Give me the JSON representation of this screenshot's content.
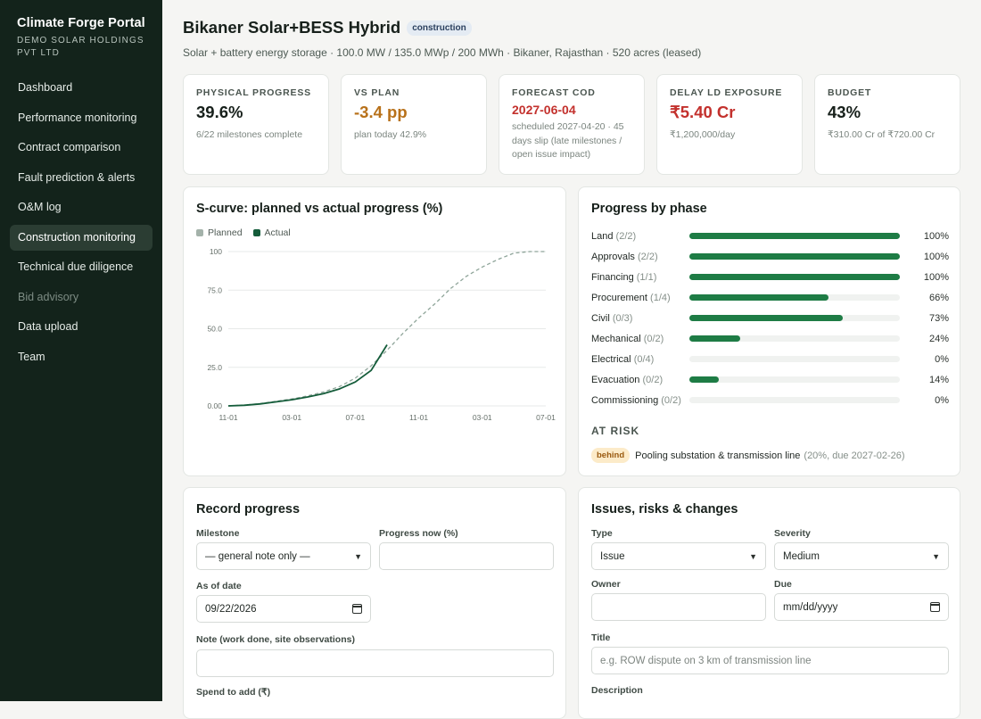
{
  "brand": {
    "title": "Climate Forge Portal",
    "subtitle": "DEMO SOLAR HOLDINGS PVT LTD"
  },
  "nav": [
    {
      "label": "Dashboard"
    },
    {
      "label": "Performance monitoring"
    },
    {
      "label": "Contract comparison"
    },
    {
      "label": "Fault prediction & alerts"
    },
    {
      "label": "O&M log"
    },
    {
      "label": "Construction monitoring",
      "active": true
    },
    {
      "label": "Technical due diligence"
    },
    {
      "label": "Bid advisory",
      "disabled": true
    },
    {
      "label": "Data upload"
    },
    {
      "label": "Team"
    }
  ],
  "header": {
    "title": "Bikaner Solar+BESS Hybrid",
    "status": "construction",
    "subtitle": "Solar + battery energy storage · 100.0 MW / 135.0 MWp / 200 MWh · Bikaner, Rajasthan · 520 acres (leased)"
  },
  "kpis": {
    "physical": {
      "label": "PHYSICAL PROGRESS",
      "value": "39.6%",
      "note": "6/22 milestones complete"
    },
    "vsplan": {
      "label": "VS PLAN",
      "value": "-3.4 pp",
      "note": "plan today 42.9%"
    },
    "cod": {
      "label": "FORECAST COD",
      "value": "2027-06-04",
      "note": "scheduled 2027-04-20 · 45 days slip (late milestones / open issue impact)"
    },
    "delay": {
      "label": "DELAY LD EXPOSURE",
      "value": "₹5.40 Cr",
      "note": "₹1,200,000/day"
    },
    "budget": {
      "label": "BUDGET",
      "value": "43%",
      "note": "₹310.00 Cr of ₹720.00 Cr"
    }
  },
  "scurve": {
    "title": "S-curve: planned vs actual progress (%)",
    "legend_planned": "Planned",
    "legend_actual": "Actual",
    "colors": {
      "planned": "#8fa59a",
      "actual": "#145c3a"
    }
  },
  "chart_data": {
    "type": "line",
    "x_ticks": [
      "11-01",
      "03-01",
      "07-01",
      "11-01",
      "03-01",
      "07-01"
    ],
    "y_ticks": [
      "0.00",
      "25.0",
      "50.0",
      "75.0",
      "100"
    ],
    "ylim": [
      0,
      100
    ],
    "x_domain_months": [
      0,
      20
    ],
    "series": [
      {
        "name": "Planned",
        "style": "dashed",
        "points": [
          [
            0,
            0
          ],
          [
            1,
            0.5
          ],
          [
            2,
            1.5
          ],
          [
            3,
            3
          ],
          [
            4,
            4.5
          ],
          [
            5,
            6.5
          ],
          [
            6,
            9
          ],
          [
            7,
            12.5
          ],
          [
            8,
            18
          ],
          [
            9,
            26
          ],
          [
            10,
            36
          ],
          [
            11,
            47
          ],
          [
            12,
            57
          ],
          [
            13,
            66
          ],
          [
            14,
            76
          ],
          [
            15,
            84
          ],
          [
            16,
            90
          ],
          [
            17,
            95
          ],
          [
            18,
            99
          ],
          [
            19,
            100
          ],
          [
            20,
            100
          ]
        ]
      },
      {
        "name": "Actual",
        "style": "solid",
        "points": [
          [
            0,
            0
          ],
          [
            1,
            0.4
          ],
          [
            2,
            1.3
          ],
          [
            3,
            2.6
          ],
          [
            4,
            4
          ],
          [
            5,
            5.8
          ],
          [
            6,
            8
          ],
          [
            7,
            11
          ],
          [
            8,
            15.5
          ],
          [
            9,
            23
          ],
          [
            10,
            39.6
          ]
        ]
      }
    ]
  },
  "phases": {
    "title": "Progress by phase",
    "items": [
      {
        "name": "Land",
        "count": "(2/2)",
        "pct": 100,
        "pct_label": "100%"
      },
      {
        "name": "Approvals",
        "count": "(2/2)",
        "pct": 100,
        "pct_label": "100%"
      },
      {
        "name": "Financing",
        "count": "(1/1)",
        "pct": 100,
        "pct_label": "100%"
      },
      {
        "name": "Procurement",
        "count": "(1/4)",
        "pct": 66,
        "pct_label": "66%"
      },
      {
        "name": "Civil",
        "count": "(0/3)",
        "pct": 73,
        "pct_label": "73%"
      },
      {
        "name": "Mechanical",
        "count": "(0/2)",
        "pct": 24,
        "pct_label": "24%"
      },
      {
        "name": "Electrical",
        "count": "(0/4)",
        "pct": 0,
        "pct_label": "0%"
      },
      {
        "name": "Evacuation",
        "count": "(0/2)",
        "pct": 14,
        "pct_label": "14%"
      },
      {
        "name": "Commissioning",
        "count": "(0/2)",
        "pct": 0,
        "pct_label": "0%"
      }
    ],
    "at_risk_heading": "AT RISK",
    "at_risk": {
      "badge": "behind",
      "text": "Pooling substation & transmission line",
      "detail": "(20%, due 2027-02-26)"
    }
  },
  "record": {
    "title": "Record progress",
    "milestone_label": "Milestone",
    "milestone_value": "— general note only —",
    "progress_label": "Progress now (%)",
    "asof_label": "As of date",
    "asof_value": "09/22/2026",
    "note_label": "Note (work done, site observations)",
    "spend_label": "Spend to add (₹)"
  },
  "issues": {
    "title": "Issues, risks & changes",
    "type_label": "Type",
    "type_value": "Issue",
    "severity_label": "Severity",
    "severity_value": "Medium",
    "owner_label": "Owner",
    "due_label": "Due",
    "due_placeholder": "mm/dd/yyyy",
    "title_label": "Title",
    "title_placeholder": "e.g. ROW dispute on 3 km of transmission line",
    "description_label": "Description"
  }
}
